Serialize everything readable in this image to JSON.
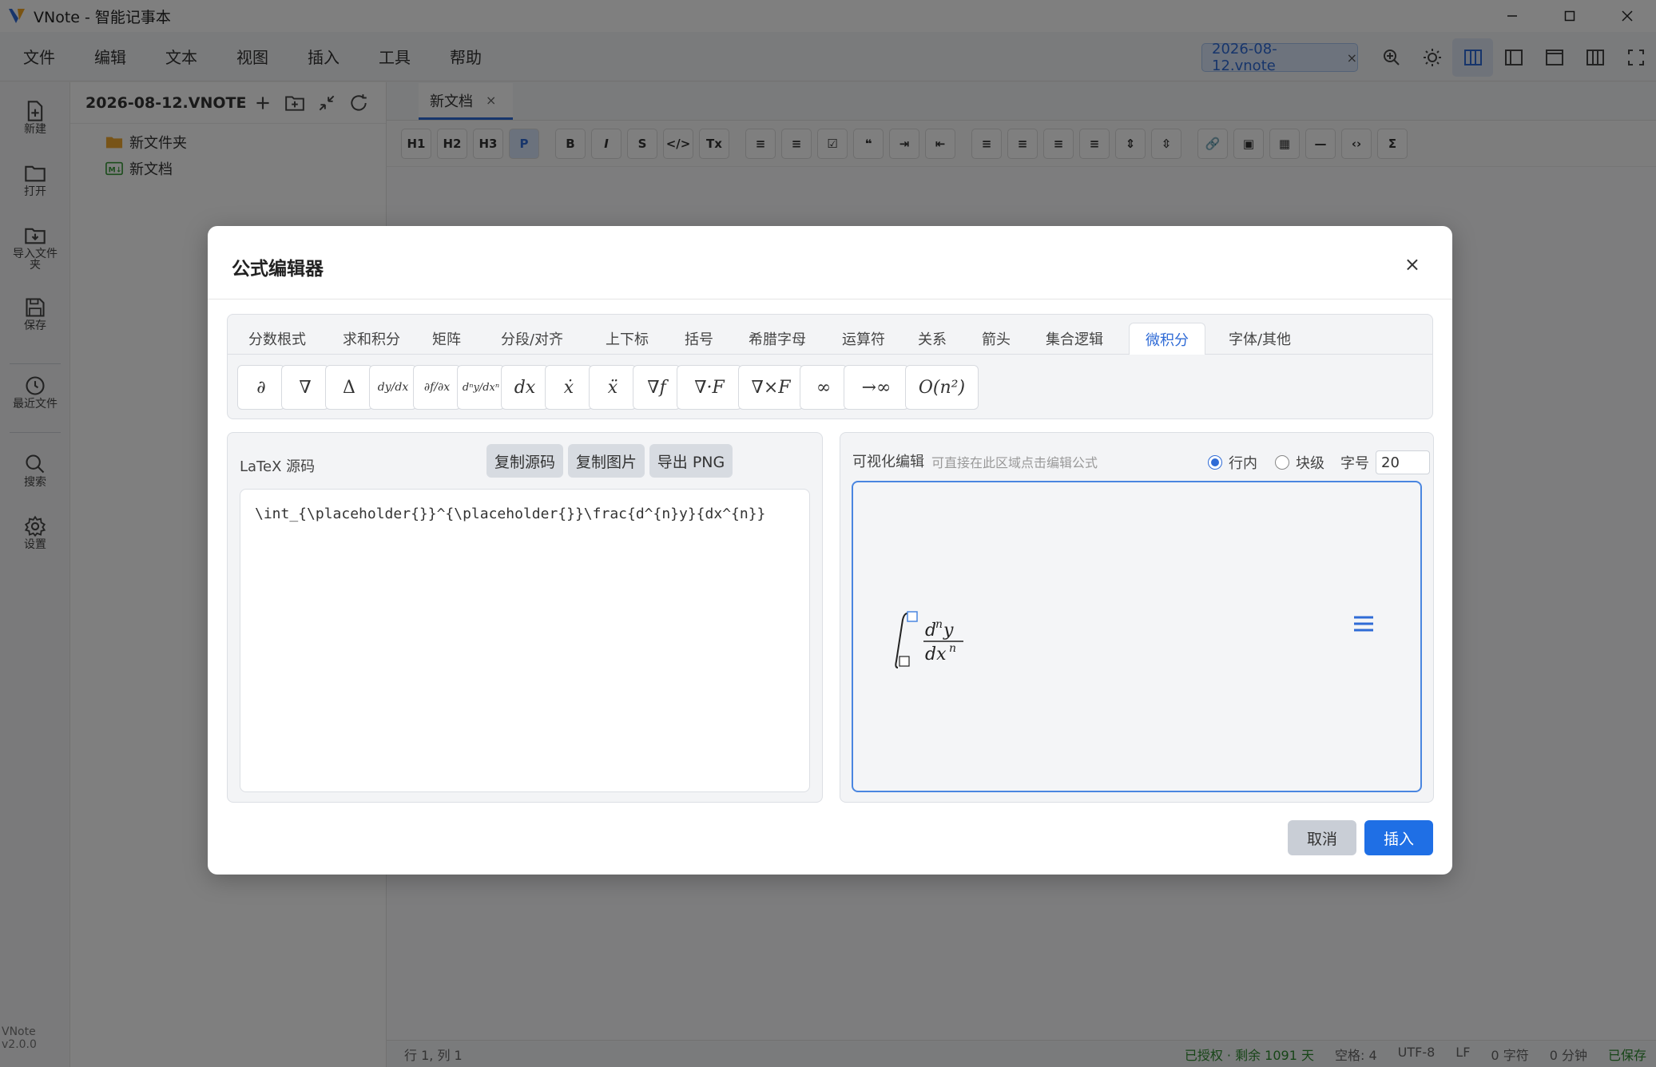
{
  "window": {
    "title": "VNote - 智能记事本"
  },
  "menu": [
    "文件",
    "编辑",
    "文本",
    "视图",
    "插入",
    "工具",
    "帮助"
  ],
  "open_file": {
    "name": "2026-08-12.vnote",
    "close": "×"
  },
  "activity": [
    {
      "name": "new",
      "label": "新建"
    },
    {
      "name": "open",
      "label": "打开"
    },
    {
      "name": "import-folder",
      "label": "导入文件夹"
    },
    {
      "name": "save",
      "label": "保存"
    },
    {
      "name": "recent-files",
      "label": "最近文件"
    },
    {
      "name": "search",
      "label": "搜索"
    },
    {
      "name": "settings",
      "label": "设置"
    }
  ],
  "version": "VNote v2.0.0",
  "explorer": {
    "title": "2026-08-12.VNOTE",
    "items": [
      {
        "label": "新文件夹",
        "type": "folder"
      },
      {
        "label": "新文档",
        "type": "markdown"
      }
    ]
  },
  "editor": {
    "tab": {
      "label": "新文档",
      "close": "×"
    },
    "toolbar": [
      "H1",
      "H2",
      "H3",
      "P",
      "B",
      "I",
      "S",
      "</>",
      "Tx"
    ]
  },
  "status": {
    "position": "行 1, 列 1",
    "license": "已授权 · 剩余 1091 天",
    "indent": "空格: 4",
    "encoding": "UTF-8",
    "eol": "LF",
    "chars": "0 字符",
    "time": "0 分钟",
    "save_state": "已保存"
  },
  "dialog": {
    "title": "公式编辑器",
    "close": "×",
    "categories": [
      "分数根式",
      "求和积分",
      "矩阵",
      "分段/对齐",
      "上下标",
      "括号",
      "希腊字母",
      "运算符",
      "关系",
      "箭头",
      "集合逻辑",
      "微积分",
      "字体/其他"
    ],
    "active_category": "微积分",
    "symbols": [
      "∂",
      "∇",
      "Δ",
      "dy/dx",
      "∂f/∂x",
      "dⁿy/dxⁿ",
      "dx",
      "ẋ",
      "ẍ",
      "∇f",
      "∇·F",
      "∇×F",
      "∞",
      "→∞",
      "O(n²)"
    ],
    "latex_label": "LaTeX 源码",
    "copy_source": "复制源码",
    "copy_image": "复制图片",
    "export_png": "导出 PNG",
    "latex_source": "\\int_{\\placeholder{}}^{\\placeholder{}}\\frac{d^{n}y}{dx^{n}}",
    "visual_label": "可视化编辑",
    "visual_hint": "可直接在此区域点击编辑公式",
    "mode_inline": "行内",
    "mode_block": "块级",
    "font_size_label": "字号",
    "font_size": "20",
    "cancel": "取消",
    "insert": "插入"
  },
  "colors": {
    "accent": "#2f6bd6",
    "primary_button": "#1f6fe5",
    "status_green": "#2e8b2e"
  }
}
